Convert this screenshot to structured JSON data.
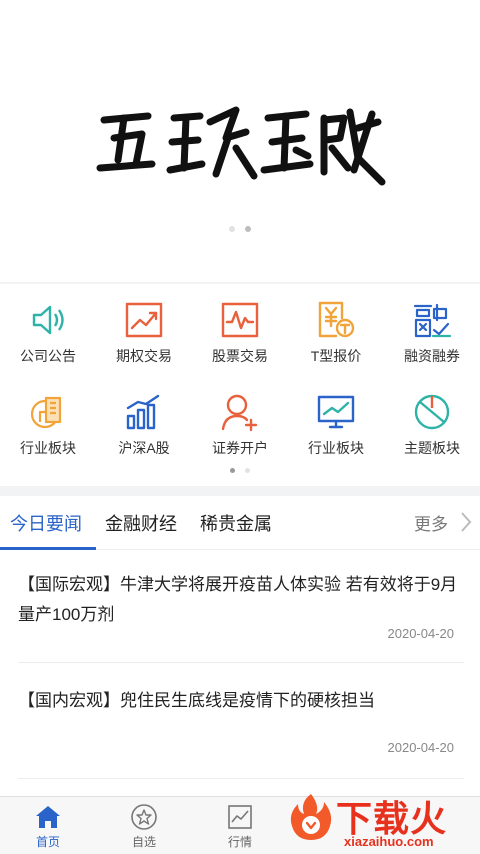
{
  "banner": {
    "calligraphy_text": "互联网 金融"
  },
  "quick_menu": [
    {
      "label": "公司公告",
      "icon": "speaker-icon",
      "color": "#2db3a8"
    },
    {
      "label": "期权交易",
      "icon": "trend-chart-icon",
      "color": "#e8603c"
    },
    {
      "label": "股票交易",
      "icon": "stock-chart-icon",
      "color": "#e8603c"
    },
    {
      "label": "T型报价",
      "icon": "yuan-doc-icon",
      "color": "#f0a43a"
    },
    {
      "label": "融资融券",
      "icon": "finance-char-icon",
      "color": "#2a63c9"
    },
    {
      "label": "行业板块",
      "icon": "coin-building-icon",
      "color": "#f0a43a"
    },
    {
      "label": "沪深A股",
      "icon": "bar-chart-icon",
      "color": "#2a63c9"
    },
    {
      "label": "证券开户",
      "icon": "add-user-icon",
      "color": "#e8603c"
    },
    {
      "label": "行业板块",
      "icon": "monitor-chart-icon",
      "color": "#2a63c9"
    },
    {
      "label": "主题板块",
      "icon": "pie-icon",
      "color": "#2db3a8"
    }
  ],
  "news": {
    "tabs": [
      "今日要闻",
      "金融财经",
      "稀贵金属"
    ],
    "more_label": "更多",
    "articles": [
      {
        "title": "【国际宏观】牛津大学将展开疫苗人体实验 若有效将于9月量产100万剂",
        "date": "2020-04-20"
      },
      {
        "title": "【国内宏观】兜住民生底线是疫情下的硬核担当",
        "date": "2020-04-20"
      }
    ]
  },
  "bottom_nav": [
    {
      "label": "首页",
      "icon": "home-icon",
      "active": true
    },
    {
      "label": "自选",
      "icon": "star-icon",
      "active": false
    },
    {
      "label": "行情",
      "icon": "market-chart-icon",
      "active": false
    }
  ],
  "watermark": {
    "text": "下载火",
    "url": "xiazaihuo.com"
  },
  "colors": {
    "accent": "#2a63c9",
    "watermark": "#e8311d"
  }
}
